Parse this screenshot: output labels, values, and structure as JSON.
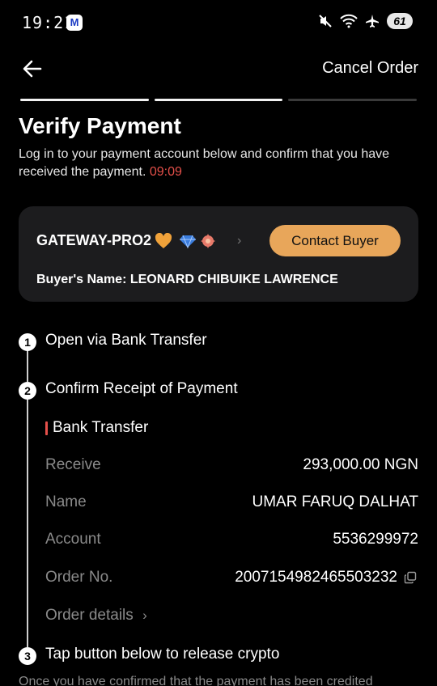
{
  "status_bar": {
    "time": "19:21",
    "badge": "M",
    "battery": "61"
  },
  "header": {
    "cancel_label": "Cancel Order"
  },
  "progress": {
    "total_steps": 3,
    "completed_steps": 2
  },
  "page": {
    "title": "Verify Payment",
    "description": "Log in to your payment account below and confirm that you have received the payment.",
    "timer": "09:09"
  },
  "buyer_card": {
    "merchant_name": "GATEWAY-PRO2",
    "contact_label": "Contact Buyer",
    "buyer_name_label": "Buyer's Name:",
    "buyer_name": "LEONARD CHIBUIKE LAWRENCE"
  },
  "steps": [
    {
      "number": "1",
      "label": "Open via Bank Transfer"
    },
    {
      "number": "2",
      "label": "Confirm Receipt of Payment"
    },
    {
      "number": "3",
      "label": "Tap button below to release crypto"
    }
  ],
  "payment": {
    "method": "Bank Transfer",
    "rows": [
      {
        "key": "Receive",
        "value": "293,000.00 NGN"
      },
      {
        "key": "Name",
        "value": "UMAR FARUQ DALHAT"
      },
      {
        "key": "Account",
        "value": "5536299972"
      },
      {
        "key": "Order No.",
        "value": "2007154982465503232"
      }
    ],
    "order_details_label": "Order details"
  },
  "footer": {
    "text": "Once you have confirmed that the payment has been credited"
  },
  "colors": {
    "accent": "#e8a65a",
    "timer": "#e5504a",
    "card_bg": "#1c1c1e"
  }
}
